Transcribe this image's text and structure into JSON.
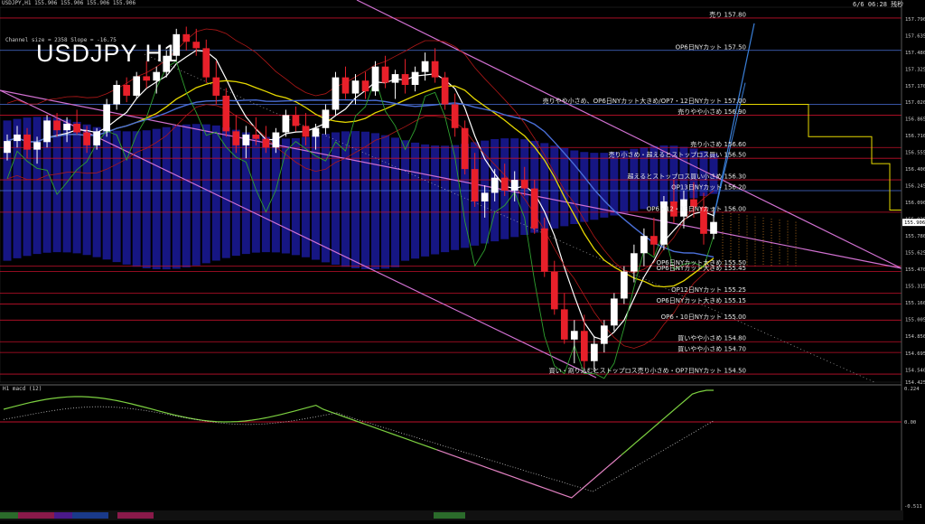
{
  "header": {
    "symbol_line": "USDJPY,H1  155.906 155.906 155.906 155.906",
    "big_title": "USDJPY H1",
    "channel_info": "Channel size = 2358 Slope = -16.75",
    "date_top": "6/6 06:28 残秒"
  },
  "macd_panel": {
    "title": "H1  macd (12)",
    "scale_top": "0.224",
    "scale_mid": "0.00",
    "scale_bottom": "-0.511"
  },
  "colors": {
    "background": "#000000",
    "candle_up": "#ffffff",
    "candle_down": "#e8202a",
    "level_line": "#c0102a",
    "blue_line": "#4a6fd8",
    "channel": "#d070d0",
    "cloud": "#1a1a9a",
    "ma_white": "#ffffff",
    "ma_yellow": "#e6d800",
    "macd_main": "#7cd040",
    "macd_low": "#e080c0",
    "macd_signal": "#c8c8c8",
    "green_line": "#2fa02f"
  },
  "chart_data": {
    "type": "candlestick",
    "title": "USDJPY H1",
    "ylim": [
      154.425,
      157.9
    ],
    "y_ticks": [
      "157.790",
      "157.635",
      "157.480",
      "157.325",
      "157.170",
      "157.020",
      "156.865",
      "156.710",
      "156.555",
      "156.400",
      "156.245",
      "156.090",
      "155.935",
      "155.780",
      "155.625",
      "155.470",
      "155.315",
      "155.160",
      "155.005",
      "154.850",
      "154.695",
      "154.540",
      "154.425"
    ],
    "current_price": "155.906",
    "current_price_value": 155.906,
    "levels": [
      {
        "price": 157.8,
        "label": "売り 157.80",
        "color": "#c0102a"
      },
      {
        "price": 157.5,
        "label": "OP6日NYカット 157.50",
        "color": "#4a6fd8"
      },
      {
        "price": 157.0,
        "label": "売りやや小さめ、OP6日NYカット大きめ/OP7・12日NYカット 157.00",
        "color": "#4a6fd8"
      },
      {
        "price": 156.9,
        "label": "売りやや小さめ 156.90",
        "color": "#c0102a"
      },
      {
        "price": 156.6,
        "label": "売り小さめ 156.60",
        "color": "#c0102a"
      },
      {
        "price": 156.5,
        "label": "売り小さめ・超えるとストップロス買い 156.50",
        "color": "#c0102a"
      },
      {
        "price": 156.3,
        "label": "超えるとストップロス買い小さめ 156.30",
        "color": "#c0102a"
      },
      {
        "price": 156.2,
        "label": "OP13日NYカット 156.20",
        "color": "#4a6fd8"
      },
      {
        "price": 156.0,
        "label": "OP6・12・13日NYカット 156.00",
        "color": "#c0102a"
      },
      {
        "price": 155.5,
        "label": "OP6日NYカット大きめ 155.50",
        "color": "#c0102a"
      },
      {
        "price": 155.45,
        "label": "OP6日NYカット大きめ 155.45",
        "color": "#c0102a"
      },
      {
        "price": 155.25,
        "label": "OP12日NYカット 155.25",
        "color": "#c0102a"
      },
      {
        "price": 155.15,
        "label": "OP6日NYカット大きめ 155.15",
        "color": "#c0102a"
      },
      {
        "price": 155.0,
        "label": "OP6・10日NYカット 155.00",
        "color": "#c0102a"
      },
      {
        "price": 154.8,
        "label": "買いやや小さめ 154.80",
        "color": "#c0102a"
      },
      {
        "price": 154.7,
        "label": "買いやや小さめ 154.70",
        "color": "#c0102a"
      },
      {
        "price": 154.5,
        "label": "買い・割り込むとストップロス売り小さめ・OP7日NYカット 154.50",
        "color": "#c0102a"
      }
    ],
    "candles": [
      [
        156.55,
        156.72,
        156.48,
        156.66
      ],
      [
        156.66,
        156.8,
        156.6,
        156.72
      ],
      [
        156.72,
        156.78,
        156.5,
        156.58
      ],
      [
        156.58,
        156.7,
        156.45,
        156.65
      ],
      [
        156.65,
        156.9,
        156.6,
        156.85
      ],
      [
        156.85,
        156.92,
        156.7,
        156.76
      ],
      [
        156.76,
        156.88,
        156.65,
        156.82
      ],
      [
        156.82,
        156.95,
        156.72,
        156.74
      ],
      [
        156.74,
        156.8,
        156.55,
        156.62
      ],
      [
        156.62,
        156.78,
        156.58,
        156.75
      ],
      [
        156.75,
        157.05,
        156.7,
        157.0
      ],
      [
        157.0,
        157.22,
        156.95,
        157.18
      ],
      [
        157.18,
        157.25,
        157.02,
        157.08
      ],
      [
        157.08,
        157.3,
        157.05,
        157.26
      ],
      [
        157.26,
        157.4,
        157.15,
        157.22
      ],
      [
        157.22,
        157.35,
        157.1,
        157.3
      ],
      [
        157.3,
        157.5,
        157.25,
        157.45
      ],
      [
        157.45,
        157.7,
        157.4,
        157.65
      ],
      [
        157.65,
        157.72,
        157.5,
        157.58
      ],
      [
        157.58,
        157.7,
        157.45,
        157.52
      ],
      [
        157.52,
        157.6,
        157.2,
        157.25
      ],
      [
        157.25,
        157.4,
        157.0,
        157.08
      ],
      [
        157.08,
        157.15,
        156.7,
        156.75
      ],
      [
        156.75,
        156.9,
        156.55,
        156.62
      ],
      [
        156.62,
        156.8,
        156.5,
        156.72
      ],
      [
        156.72,
        156.88,
        156.62,
        156.68
      ],
      [
        156.68,
        156.8,
        156.55,
        156.6
      ],
      [
        156.6,
        156.78,
        156.55,
        156.74
      ],
      [
        156.74,
        156.95,
        156.7,
        156.9
      ],
      [
        156.9,
        156.98,
        156.75,
        156.8
      ],
      [
        156.8,
        156.92,
        156.62,
        156.7
      ],
      [
        156.7,
        156.82,
        156.58,
        156.78
      ],
      [
        156.78,
        157.0,
        156.72,
        156.95
      ],
      [
        156.95,
        157.3,
        156.9,
        157.25
      ],
      [
        157.25,
        157.35,
        157.05,
        157.1
      ],
      [
        157.1,
        157.28,
        157.0,
        157.22
      ],
      [
        157.22,
        157.3,
        157.05,
        157.12
      ],
      [
        157.12,
        157.4,
        157.08,
        157.35
      ],
      [
        157.35,
        157.45,
        157.15,
        157.2
      ],
      [
        157.2,
        157.32,
        157.05,
        157.28
      ],
      [
        157.28,
        157.42,
        157.1,
        157.18
      ],
      [
        157.18,
        157.35,
        157.12,
        157.3
      ],
      [
        157.3,
        157.48,
        157.22,
        157.4
      ],
      [
        157.4,
        157.52,
        157.2,
        157.25
      ],
      [
        157.25,
        157.3,
        156.95,
        157.0
      ],
      [
        157.0,
        157.1,
        156.7,
        156.78
      ],
      [
        156.78,
        156.85,
        156.35,
        156.4
      ],
      [
        156.4,
        156.55,
        156.05,
        156.1
      ],
      [
        156.1,
        156.25,
        155.95,
        156.18
      ],
      [
        156.18,
        156.4,
        156.1,
        156.32
      ],
      [
        156.32,
        156.45,
        156.15,
        156.2
      ],
      [
        156.2,
        156.38,
        156.1,
        156.3
      ],
      [
        156.3,
        156.42,
        156.15,
        156.22
      ],
      [
        156.22,
        156.3,
        155.8,
        155.85
      ],
      [
        155.85,
        155.95,
        155.4,
        155.45
      ],
      [
        155.45,
        155.55,
        155.05,
        155.1
      ],
      [
        155.1,
        155.25,
        154.78,
        154.82
      ],
      [
        154.82,
        155.0,
        154.6,
        154.9
      ],
      [
        154.9,
        155.05,
        154.55,
        154.62
      ],
      [
        154.62,
        154.85,
        154.52,
        154.78
      ],
      [
        154.78,
        155.0,
        154.7,
        154.95
      ],
      [
        154.95,
        155.25,
        154.9,
        155.2
      ],
      [
        155.2,
        155.5,
        155.15,
        155.45
      ],
      [
        155.45,
        155.7,
        155.35,
        155.62
      ],
      [
        155.62,
        155.85,
        155.5,
        155.78
      ],
      [
        155.78,
        155.95,
        155.6,
        155.7
      ],
      [
        155.7,
        156.15,
        155.65,
        156.1
      ],
      [
        156.1,
        156.3,
        155.9,
        155.96
      ],
      [
        155.96,
        156.2,
        155.85,
        156.12
      ],
      [
        156.12,
        156.28,
        155.95,
        156.05
      ],
      [
        156.05,
        156.18,
        155.7,
        155.8
      ],
      [
        155.8,
        156.05,
        155.75,
        155.91
      ]
    ]
  }
}
